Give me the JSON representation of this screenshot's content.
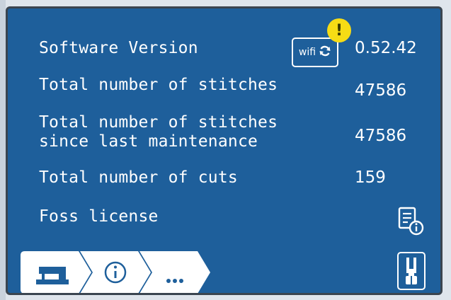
{
  "rows": [
    {
      "label": "Software Version",
      "value": "0.52.42"
    },
    {
      "label": "Total number of stitches",
      "value": "47586"
    },
    {
      "label_line1": "Total number of stitches",
      "label_line2": "since last maintenance",
      "value": "47586"
    },
    {
      "label": "Total number of cuts",
      "value": "159"
    },
    {
      "label": "Foss license"
    }
  ],
  "wifi_button": {
    "label": "wifi",
    "icon": "refresh-icon"
  },
  "alert_badge": {
    "text": "!"
  },
  "tabs": [
    {
      "name": "machine",
      "icon": "sewing-machine-icon"
    },
    {
      "name": "info",
      "icon": "info-icon",
      "active": true
    },
    {
      "name": "more",
      "icon": "more-icon",
      "text": "..."
    }
  ],
  "colors": {
    "background": "#1e5f9b",
    "tab": "#ffffff",
    "alert": "#f6dc15"
  }
}
